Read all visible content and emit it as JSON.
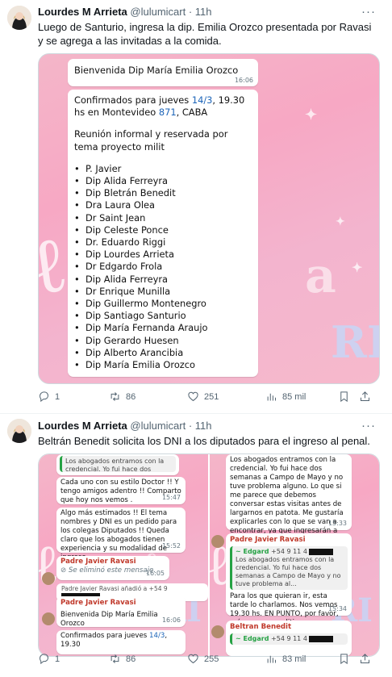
{
  "tweets": [
    {
      "author_name": "Lourdes M Arrieta",
      "handle": "@lulumicart",
      "time": "11h",
      "text": "Luego de Santurio, ingresa la dip. Emilia Orozco presentada por Ravasi y se agrega a las invitadas a la comida.",
      "stats": {
        "replies": "1",
        "retweets": "86",
        "likes": "251",
        "views": "85 mil"
      },
      "image": {
        "welcome": {
          "text": "Bienvenida Dip María Emilia Orozco",
          "time": "16:06"
        },
        "main": {
          "confirm_pre": "Confirmados para jueves ",
          "confirm_date": "14/3",
          "confirm_mid": ", 19.30 hs en Montevideo ",
          "confirm_num": "871",
          "confirm_post": ", CABA",
          "meeting": "Reunión informal y reservada por tema proyecto milit",
          "attendees": [
            "P. Javier",
            "Dip Alida Ferreyra",
            "Dip Bletrán Benedit",
            "Dra Laura Olea",
            "Dr Saint Jean",
            "Dip Celeste Ponce",
            "Dr. Eduardo Riggi",
            "Dip Lourdes Arrieta",
            "Dr Edgardo Frola",
            "Dip Alida Ferreyra",
            "Dr Enrique Munilla",
            "Dip Guillermo Montenegro",
            "Dip Santiago Santurio",
            "Dip María Fernanda Araujo",
            "Dip Gerardo Huesen",
            "Dip Alberto Arancibia",
            "Dip María Emilia Orozco"
          ]
        }
      }
    },
    {
      "author_name": "Lourdes M Arrieta",
      "handle": "@lulumicart",
      "time": "11h",
      "text": "Beltrán Benedit solicita los DNI a los diputados para el ingreso al penal.",
      "stats": {
        "replies": "1",
        "retweets": "86",
        "likes": "255",
        "views": "83 mil"
      },
      "image_left": {
        "quote_top": "Los abogados entramos con la credencial. Yo fui hace dos semanas a Campo de Mayo y no tuve problema al...",
        "m1": {
          "text": "Cada uno con su estilo Doctor !! Y tengo amigos adentro !! Comparto que hoy nos vemos .",
          "time": "15:47"
        },
        "m2": {
          "text": "Algo más estimados !! El tema nombres y DNI es un pedido para los colegas Diputados !! Queda claro que los abogados tienen experiencia y su modalidad de ingreso .",
          "time": "15:52"
        },
        "sender1": "Padre Javier Ravasi",
        "deleted": {
          "text": "Se eliminó este mensaje.",
          "time": "16:05"
        },
        "added": "Padre Javier Ravasi añadió a +54 9",
        "sender2": "Padre Javier Ravasi",
        "welcome": {
          "text": "Bienvenida Dip María Emilia Orozco",
          "time": "16:06"
        },
        "confirm_pre": "Confirmados para jueves ",
        "confirm_date": "14/3",
        "confirm_post": ", 19.30"
      },
      "image_right": {
        "m1": {
          "text": "Los abogados entramos con la credencial. Yo fui hace dos semanas a Campo de Mayo y no tuve problema alguno. Lo que si me parece que debemos conversar estas visitas antes de largarnos en patota. Me gustaría explicarles con lo que se van a encontrar, ya que ingresarán a un geriátrico mas que a una cárcel.",
          "time": "15:33"
        },
        "sender1": "Padre Javier Ravasi",
        "quote_name": "~ Edgard",
        "quote_phone": "+54 9 11 4",
        "quote_text": "Los abogados entramos con la credencial. Yo fui hace dos semanas a Campo de Mayo y no tuve problema al...",
        "reply": {
          "text": "Para los que quieran ir, esta tarde lo charlamos. Nos vemos 19.30 hs. EN PUNTO, por favor, así somos expeditivos.",
          "time": "15:34"
        },
        "sender2": "Beltran Benedit",
        "quote2_name": "~ Edgard",
        "quote2_phone": "+54 9 11 4"
      }
    }
  ],
  "icons": [
    "more-icon",
    "reply-icon",
    "retweet-icon",
    "like-icon",
    "views-icon",
    "bookmark-icon",
    "share-icon"
  ],
  "colors": {
    "accent_pink": "#f7a8c4",
    "link": "#1c64b8",
    "muted": "#536471"
  }
}
